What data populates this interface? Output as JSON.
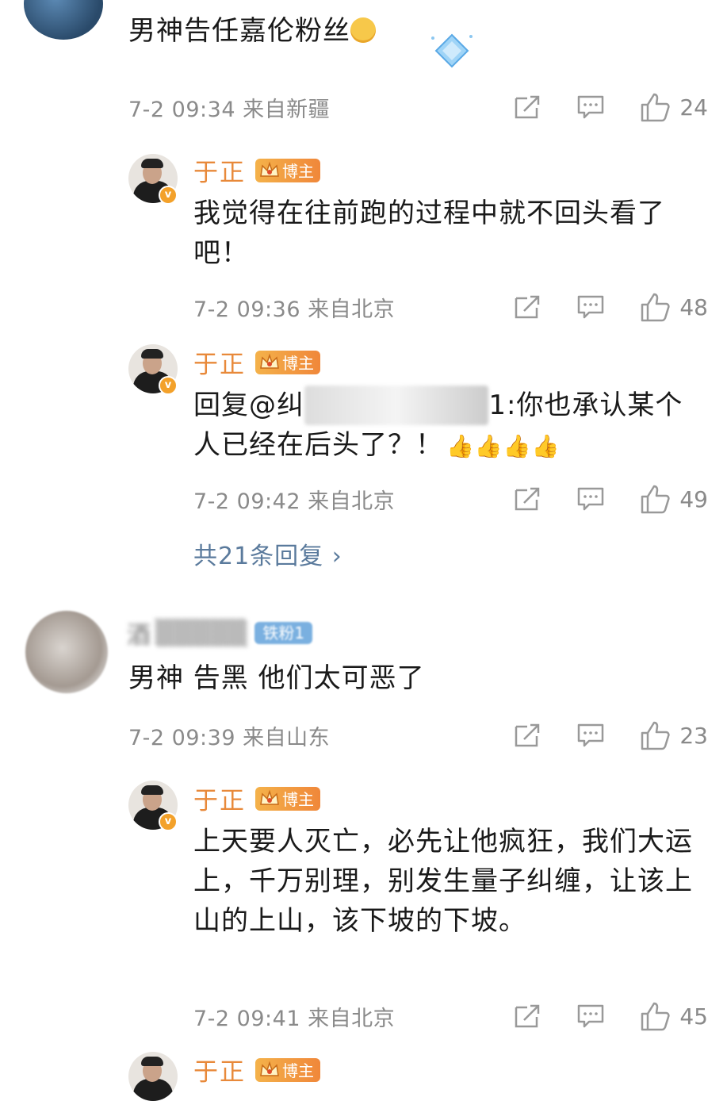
{
  "comments": [
    {
      "text": "男神告任嘉伦粉丝",
      "meta": "7-2 09:34  来自新疆",
      "likes": "24",
      "replies": [
        {
          "user": "于正",
          "tag": "博主",
          "text": "我觉得在往前跑的过程中就不回头看了吧！",
          "meta": "7-2 09:36  来自北京",
          "likes": "48"
        },
        {
          "user": "于正",
          "tag": "博主",
          "text_prefix": "回复@纠",
          "text_suffix": "1:你也承认某个人已经在后头了？！",
          "meta": "7-2 09:42  来自北京",
          "likes": "49"
        }
      ],
      "more_replies": "共21条回复 ›"
    },
    {
      "user": "酒",
      "fan_tag": "铁粉1",
      "text": "男神 告黑 他们太可恶了",
      "meta": "7-2 09:39  来自山东",
      "likes": "23",
      "replies": [
        {
          "user": "于正",
          "tag": "博主",
          "text": "上天要人灭亡，必先让他疯狂，我们大运上，千万别理，别发生量子纠缠，让该上山的上山，该下坡的下坡。",
          "meta": "7-2 09:41  来自北京",
          "likes": "45"
        },
        {
          "user": "于正",
          "tag": "博主"
        }
      ]
    }
  ],
  "icons": {
    "share": "share-icon",
    "comment": "comment-icon",
    "like": "thumbs-up-icon"
  },
  "colors": {
    "username": "#e8893a",
    "meta": "#8a8a8a",
    "link": "#5a7a9c",
    "tag": "#f0873a"
  }
}
